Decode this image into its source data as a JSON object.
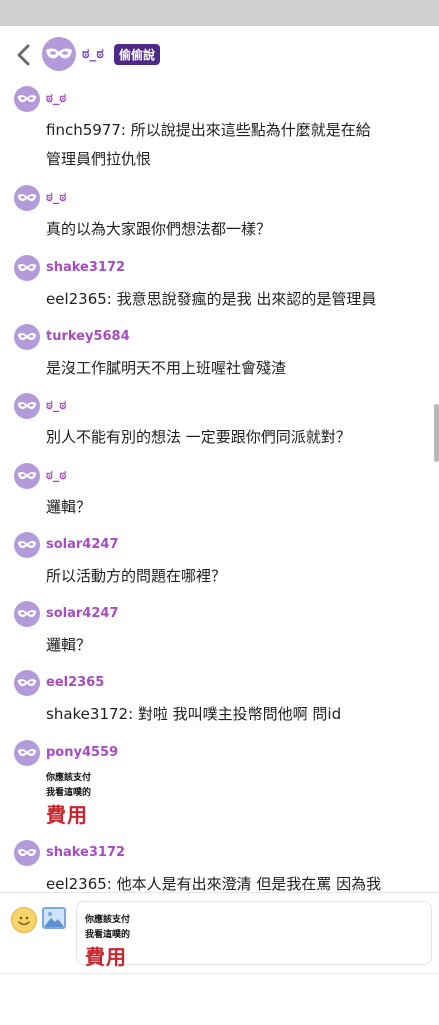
{
  "header": {
    "name": "ಠ_ಠ",
    "badge": "偷偷說",
    "back_icon": "chevron-left-icon",
    "avatar_icon": "mask-icon"
  },
  "messages": [
    {
      "name": "ಠ_ಠ",
      "lines": [
        "finch5977: 所以說提出來這些點為什麼就是在給",
        "管理員們拉仇恨"
      ]
    },
    {
      "name": "ಠ_ಠ",
      "lines": [
        "真的以為大家跟你們想法都一樣？"
      ]
    },
    {
      "name": "shake3172",
      "lines": [
        "eel2365: 我意思說發瘋的是我 出來認的是管理員"
      ]
    },
    {
      "name": "turkey5684",
      "lines": [
        "是沒工作膩明天不用上班喔社會殘渣"
      ]
    },
    {
      "name": "ಠ_ಠ",
      "lines": [
        "別人不能有別的想法 一定要跟你們同派就對？"
      ]
    },
    {
      "name": "ಠ_ಠ",
      "lines": [
        "邏輯？"
      ]
    },
    {
      "name": "solar4247",
      "lines": [
        "所以活動方的問題在哪裡？"
      ]
    },
    {
      "name": "solar4247",
      "lines": [
        "邏輯？"
      ]
    },
    {
      "name": "eel2365",
      "lines": [
        "shake3172: 對啦 我叫噗主投幣問他啊 問id"
      ]
    },
    {
      "name": "pony4559",
      "sticker": {
        "line1": "你應該支付",
        "line2": "我看這噗的",
        "line3": "費用"
      }
    },
    {
      "name": "shake3172",
      "lines": [
        "eel2365: 他本人是有出來澄清 但是我在罵 因為我"
      ]
    }
  ],
  "composer": {
    "emoji_icon": "smiley-icon",
    "image_icon": "image-icon",
    "preview": {
      "line1": "你應該支付",
      "line2": "我看這噗的",
      "line3": "費用"
    }
  },
  "colors": {
    "username": "#a64cc0",
    "avatar_bg": "#b39ad8",
    "badge_bg": "#4d2a86",
    "sticker_red": "#c8262d"
  }
}
